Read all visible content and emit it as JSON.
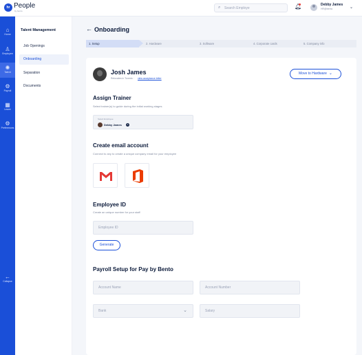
{
  "app": {
    "logo_mark": "hr",
    "logo_text": "People",
    "logo_sub": "by bento"
  },
  "header": {
    "search_placeholder": "Search Employe",
    "user_name": "Debby James",
    "user_role": "HR@bento"
  },
  "rail": {
    "items": [
      {
        "label": "Home",
        "icon": "home-icon",
        "glyph": "⌂"
      },
      {
        "label": "Employee",
        "icon": "person-icon",
        "glyph": "♙"
      },
      {
        "label": "Talent",
        "icon": "talent-icon",
        "glyph": "✺"
      },
      {
        "label": "Payroll",
        "icon": "payroll-icon",
        "glyph": "⚙"
      },
      {
        "label": "Leave",
        "icon": "calendar-icon",
        "glyph": "▦"
      },
      {
        "label": "Preferences",
        "icon": "gear-icon",
        "glyph": "⚙"
      }
    ],
    "active_index": 2,
    "collapse_label": "Collapse",
    "collapse_glyph": "←"
  },
  "subnav": {
    "title": "Talent Management",
    "items": [
      "Job Openings",
      "Onboarding",
      "Separation",
      "Documents"
    ],
    "active_index": 1
  },
  "page": {
    "back_glyph": "←",
    "title": "Onboarding"
  },
  "stepper": {
    "steps": [
      "1. Setup",
      "2. Hardware",
      "3. Software",
      "4. Corporate cards",
      "5. Company info"
    ],
    "active_index": 0
  },
  "employee": {
    "name": "Josh James",
    "location": "Relocates in Tuxedo ·",
    "link_text": "view acceptance letter",
    "move_button": "Move to Hardware"
  },
  "assign_trainer": {
    "title": "Assign Trainer",
    "subtitle": "Select trainer(s) to guide during the initial working stages",
    "field_label": "Select Employee",
    "selected_name": "Debby James"
  },
  "email_account": {
    "title": "Create email account",
    "subtitle": "Connect to any to create a unique company email for your employee",
    "providers": [
      "gmail-icon",
      "office-icon"
    ]
  },
  "employee_id": {
    "title": "Employee ID",
    "subtitle": "Create an unique number for your staff",
    "placeholder": "Employee ID",
    "generate_button": "Generate"
  },
  "payroll": {
    "title": "Payroll Setup for Pay by Bento",
    "account_name_placeholder": "Account Name",
    "account_number_placeholder": "Account Number",
    "bank_placeholder": "Bank",
    "salary_placeholder": "Salary"
  },
  "colors": {
    "brand": "#1a4fd8",
    "rail_bg": "#1a4fd8",
    "page_bg": "#f4f6fa",
    "gmail_red": "#e53935",
    "office_orange": "#eb3c00"
  }
}
